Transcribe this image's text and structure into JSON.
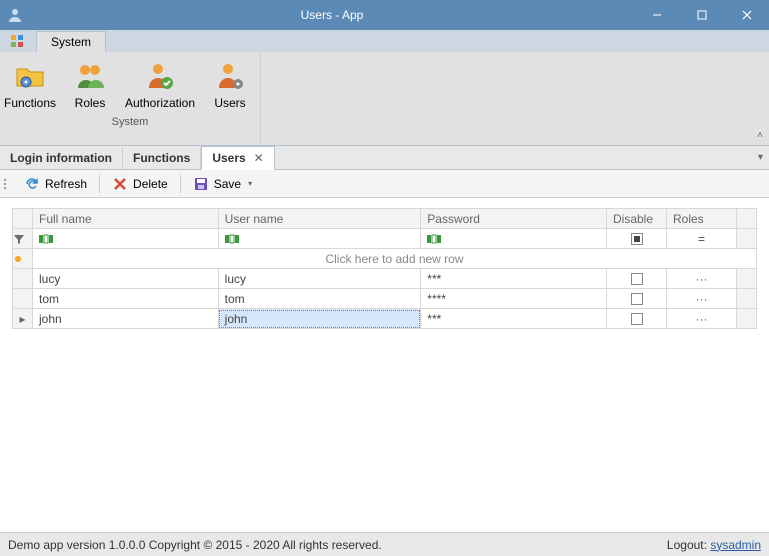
{
  "window": {
    "title": "Users - App"
  },
  "ribbon": {
    "activeTab": "System",
    "group": "System",
    "items": {
      "functions": "Functions",
      "roles": "Roles",
      "authorization": "Authorization",
      "users": "Users"
    }
  },
  "docTabs": {
    "login": "Login information",
    "functions": "Functions",
    "users": "Users"
  },
  "toolbar": {
    "refresh": "Refresh",
    "delete": "Delete",
    "save": "Save"
  },
  "grid": {
    "headers": {
      "fullname": "Full name",
      "username": "User name",
      "password": "Password",
      "disable": "Disable",
      "roles": "Roles"
    },
    "addRow": "Click here to add new row",
    "rows": [
      {
        "fullname": "lucy",
        "username": "lucy",
        "password": "***",
        "disable": false
      },
      {
        "fullname": "tom",
        "username": "tom",
        "password": "****",
        "disable": false
      },
      {
        "fullname": "john",
        "username": "john",
        "password": "***",
        "disable": false
      }
    ],
    "editing": {
      "row": 2,
      "col": "username"
    }
  },
  "status": {
    "text": "Demo app version 1.0.0.0 Copyright © 2015 - 2020 All rights reserved.",
    "logoutLabel": "Logout:",
    "user": "sysadmin"
  }
}
